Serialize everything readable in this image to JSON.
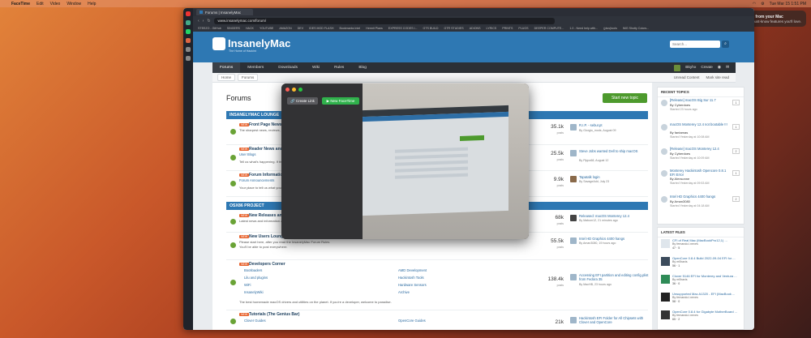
{
  "menubar": {
    "app": "FaceTime",
    "items": [
      "Edit",
      "Video",
      "Window",
      "Help"
    ],
    "clock": "Tue Mar 15  1:51 PM"
  },
  "notification": {
    "title": "Get more from your Mac",
    "body": "Discover must-know features you'll love."
  },
  "browser": {
    "tab_title": "Forums | InsanelyMac",
    "url": "www.insanelymac.com/forum/",
    "bookmarks": [
      "STEEZO - GitHub",
      "SINGERS",
      "HACK",
      "YOUTUBE",
      "AMAZON",
      "DEV",
      "IDES MOD FLASH",
      "Bookmarks Intel",
      "Hermit Plans",
      "EXPRESS CODES I...",
      "GTS BUILD",
      "GTR STUDIES",
      "ADIONS",
      "LYRICS",
      "PRINTS",
      "PLUGS",
      "DEEPER COMPUTE...",
      "1.0 - Need help with...",
      "(plus)tools",
      "IMG Shotty Colors..."
    ]
  },
  "site": {
    "logo": "InsanelyMac",
    "logo_sub": "The Home of Hackint",
    "search_placeholder": "Search..."
  },
  "nav": {
    "items": [
      "Forums",
      "Members",
      "Downloads",
      "Wiki",
      "Rules",
      "Blog"
    ],
    "user": "Bkyhx",
    "create": "Create"
  },
  "subbar": {
    "crumbs": [
      "Home",
      "Forums"
    ],
    "unread": "Unread Content",
    "mark_read": "Mark site read"
  },
  "main": {
    "title": "Forums",
    "start_topic": "Start new topic",
    "badge_new": "NEW",
    "categories": [
      "INSANELYMAC LOUNGE",
      "OSX86 PROJECT"
    ],
    "rows": [
      {
        "title": "Front Page News and Ru",
        "desc": "The sharpest news, reviews, and o",
        "count": "35.1k",
        "posts": "posts",
        "last": "R.I.P. - sebur.pt",
        "by": "By Giorgio_mods, August 09"
      },
      {
        "title": "Reader News and Review",
        "sub": "User Blogs",
        "desc": "Tell us what's happening. If the con",
        "count": "25.5k",
        "posts": "posts",
        "last": "Steve Jobs wanted Dell to ship macOS",
        "by": "By Pippo68, August 12"
      },
      {
        "title": "Forum Information and F",
        "sub": "Forum Announcements",
        "desc": "Your place to tell us what you think",
        "count": "9.9k",
        "posts": "posts",
        "last": "Tapatalk login",
        "by": "By SavageAdd, July 23"
      },
      {
        "title": "New Releases and Upda",
        "desc": "Latest news and information all the",
        "count": "68k",
        "posts": "posts",
        "last": "Released: macOS Monterey 12.4",
        "by": "By Mabom12, 21 minutes ago"
      },
      {
        "title": "New Users Lounge",
        "desc": "Please start here, after you read the InsanelyMac Forum Rules",
        "desc2": "You'll be able to post everywhere.",
        "count": "55.5k",
        "posts": "posts",
        "last": "Intel HD Graphics 4400 hangs",
        "by": "By Aman3080, 19 hours ago"
      },
      {
        "title": "Developers Corner",
        "desc": "The best homemade macOS drivers and utilities on the planet. If you're a developer, welcome to paradise.",
        "count": "138.4k",
        "posts": "posts",
        "last": "Accessing EFI partition and editing config.plist from Fedora 35",
        "by": "By MacHB, 23 hours ago"
      },
      {
        "title": "Tutorials (The Genius Bar)",
        "count": "21k",
        "posts": "posts",
        "last": "Hackintosh EFI Folder for All Chipsets with Clover and OpenCore",
        "by": ""
      }
    ],
    "dev_links": [
      "Bootloaders",
      "Lilu and plugins",
      "WiFi",
      "InsanelyWiki"
    ],
    "dev_links_right": [
      "AMD Development",
      "Hackintosh Tools",
      "Hardware Sensors",
      "Archive"
    ],
    "tut_links": [
      "Clover Guides",
      "OpenCore Guides"
    ]
  },
  "sidebar": {
    "recent_title": "RECENT TOPICS",
    "recent": [
      {
        "title": "[Release] macOS Big Sur 11.7",
        "by": "By Cyberdoes",
        "time": "Started 23 hours ago",
        "count": "1"
      },
      {
        "title": "macOS Monterey 12.4 not bootable !!!",
        "by": "By fantamas",
        "time": "Started Yesterday at 10:08 AM",
        "count": "1"
      },
      {
        "title": "[Release] macOS Monterey 12.4",
        "by": "By Cyberdoes",
        "time": "Started Yesterday at 10:09 AM",
        "count": "2"
      },
      {
        "title": "Monterey Hackintosh Opencore 0.8.1 EFI Error",
        "by": "By Alexsonne",
        "time": "Started Yesterday at 09:53 AM",
        "count": "1"
      },
      {
        "title": "Intel HD Graphics 4400 hangs",
        "by": "By Aman3080",
        "time": "Started Yesterday at 04:18 AM",
        "count": "2"
      }
    ],
    "files_title": "LATEST FILES",
    "files": [
      {
        "title": "CFI of Real Mac (MacBookPro12,1) ...",
        "by": "By fernando.l.neves",
        "stats": "47 · 5"
      },
      {
        "title": "OpenCore 0.8.4 Build 2022-09-04 EFI for ...",
        "by": "By m0havis",
        "stats": "56 · 1"
      },
      {
        "title": "Clover 5146 EFI for Monterey and Ventura ...",
        "by": "By m0havis",
        "stats": "36 · 0"
      },
      {
        "title": "Unsupported Mac A1320 - EFI (MacBook ...",
        "by": "By fernando.l.neves",
        "stats": "58 · 0"
      },
      {
        "title": "OpenCore 0.8.4 for Gigabyte MotherBoard ...",
        "by": "By fernando.l.neves",
        "stats": "65 · 2"
      }
    ]
  },
  "facetime": {
    "create_link": "Create Link",
    "new_facetime": "New FaceTime"
  }
}
